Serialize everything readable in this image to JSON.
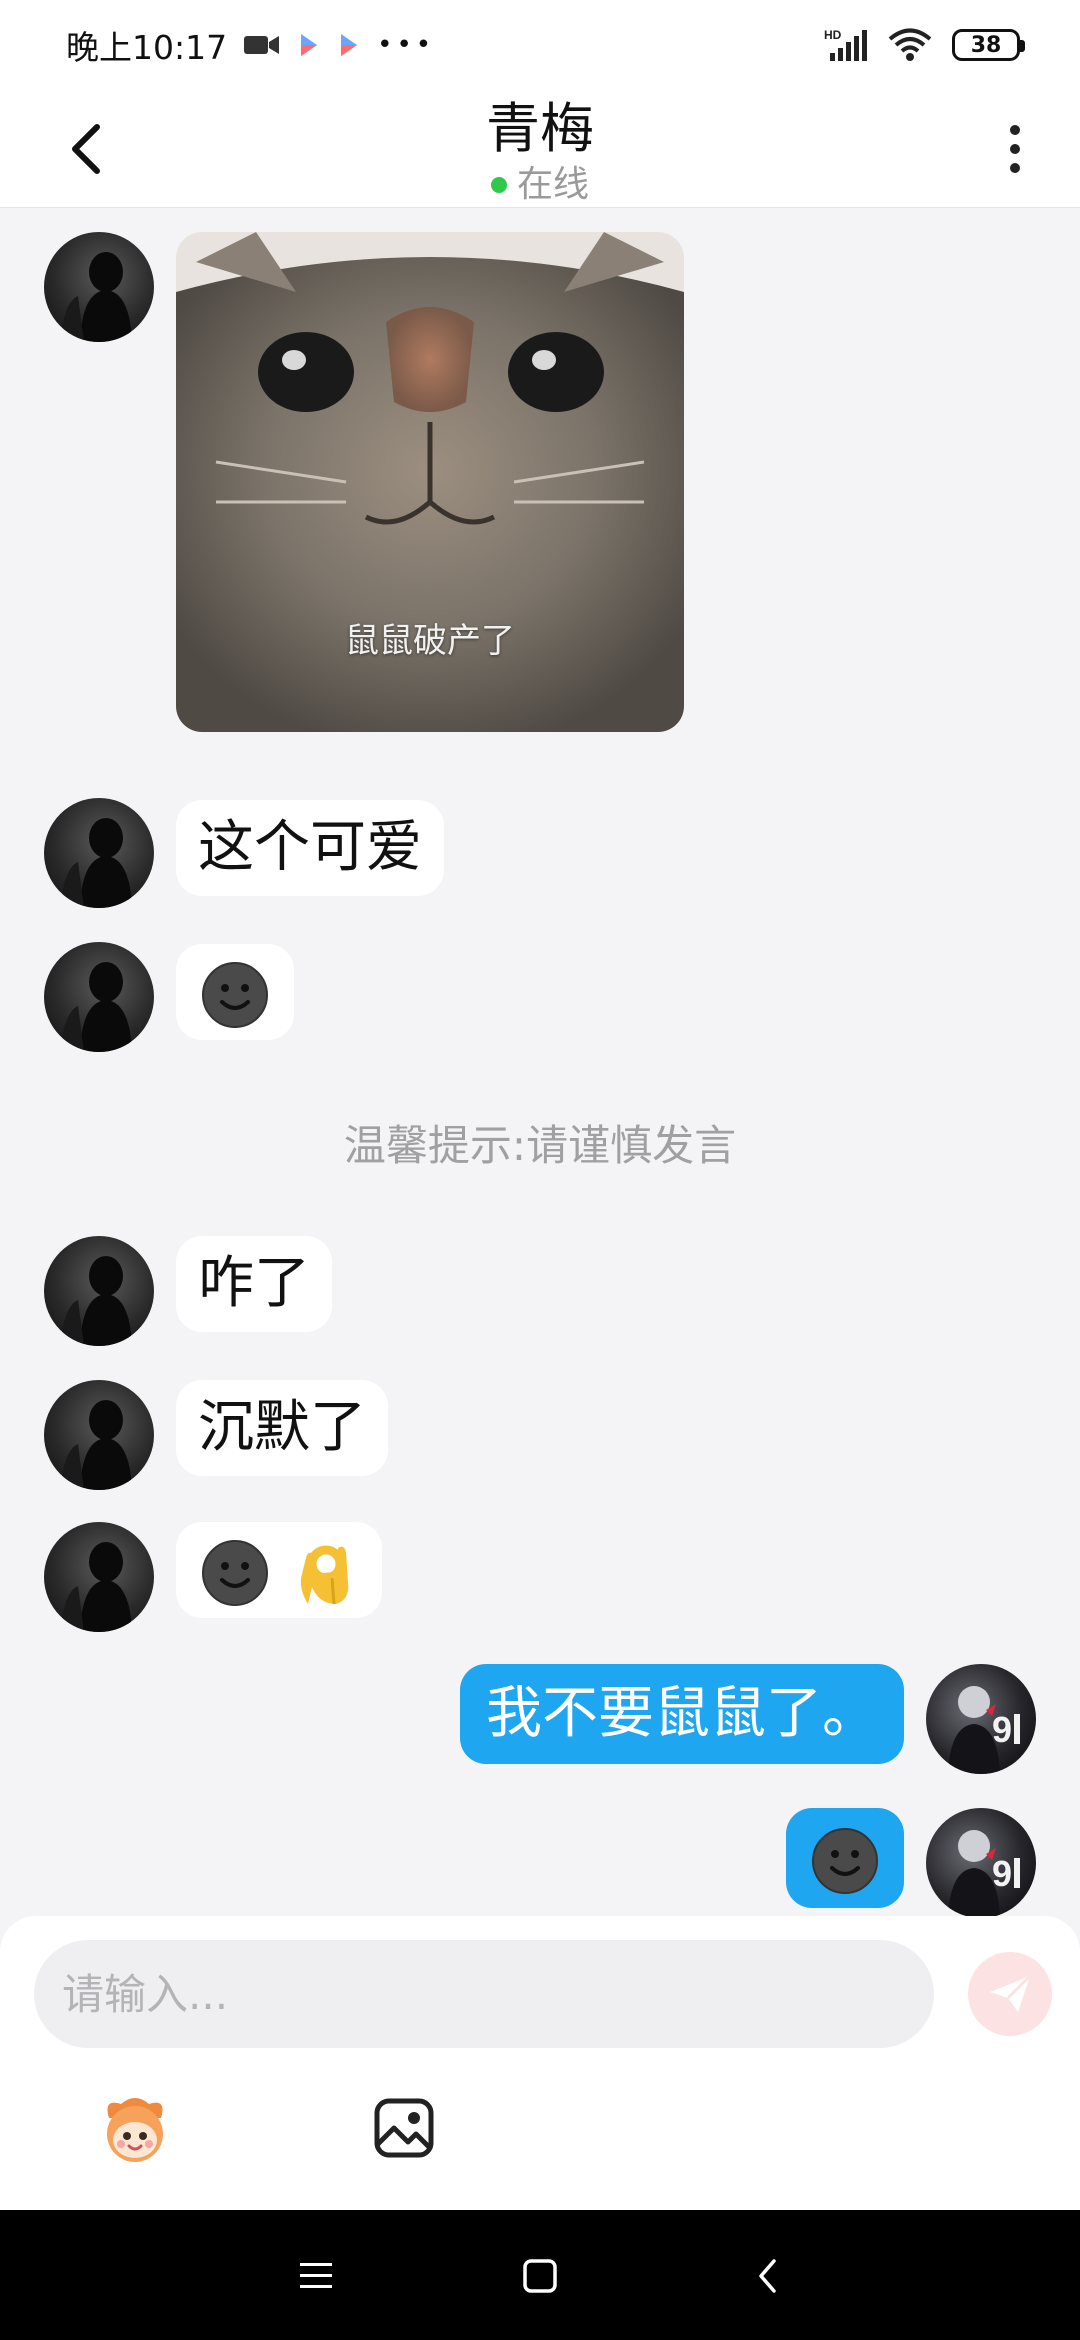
{
  "status_bar": {
    "time": "晚上10:17",
    "more": "•••",
    "battery": "38",
    "icons": [
      "video-camera-icon",
      "play-store-icon",
      "play-store-icon",
      "hd-signal-icon",
      "wifi-icon",
      "battery-icon"
    ]
  },
  "header": {
    "title": "青梅",
    "status": "在线",
    "status_color": "#2ec94a"
  },
  "messages": [
    {
      "from": "peer",
      "type": "image",
      "caption": "鼠鼠破产了"
    },
    {
      "from": "peer",
      "type": "text",
      "text": "这个可爱"
    },
    {
      "from": "peer",
      "type": "emoji",
      "emoji": [
        "dark-smile-emoji"
      ]
    },
    {
      "from": "peer",
      "type": "text",
      "text": "咋了"
    },
    {
      "from": "peer",
      "type": "text",
      "text": "沉默了"
    },
    {
      "from": "peer",
      "type": "emoji",
      "emoji": [
        "dark-smile-emoji",
        "ok-hand-emoji"
      ]
    },
    {
      "from": "self",
      "type": "text",
      "text": "我不要鼠鼠了。"
    },
    {
      "from": "self",
      "type": "emoji",
      "emoji": [
        "dark-smile-emoji"
      ]
    }
  ],
  "tip": "温馨提示:请谨慎发言",
  "input": {
    "placeholder": "请输入...",
    "value": ""
  },
  "colors": {
    "self_bubble": "#1ea6f0",
    "send_button": "#fde2e4",
    "background": "#f4f4f7"
  }
}
